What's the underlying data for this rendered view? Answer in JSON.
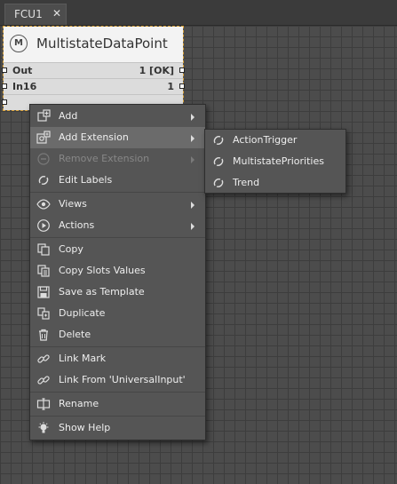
{
  "tab": {
    "label": "FCU1",
    "close_glyph": "✕"
  },
  "node": {
    "title": "MultistateDataPoint",
    "icon_letter": "M",
    "icon": "multistate-icon",
    "slots": [
      {
        "name": "Out",
        "value": "1 [OK]"
      },
      {
        "name": "In16",
        "value": "1"
      }
    ]
  },
  "context_menu": {
    "items": [
      {
        "label": "Add",
        "icon": "add-icon",
        "submenu": true
      },
      {
        "label": "Add Extension",
        "icon": "add-extension-icon",
        "submenu": true,
        "highlighted": true
      },
      {
        "label": "Remove Extension",
        "icon": "remove-extension-icon",
        "submenu": true,
        "disabled": true
      },
      {
        "label": "Edit Labels",
        "icon": "edit-labels-icon"
      },
      {
        "label": "Views",
        "icon": "eye-icon",
        "submenu": true
      },
      {
        "label": "Actions",
        "icon": "play-icon",
        "submenu": true
      },
      {
        "label": "Copy",
        "icon": "copy-icon"
      },
      {
        "label": "Copy Slots Values",
        "icon": "copy-slots-icon"
      },
      {
        "label": "Save as Template",
        "icon": "save-template-icon"
      },
      {
        "label": "Duplicate",
        "icon": "duplicate-icon"
      },
      {
        "label": "Delete",
        "icon": "trash-icon"
      },
      {
        "label": "Link Mark",
        "icon": "link-icon"
      },
      {
        "label": "Link From 'UniversalInput'",
        "icon": "link-from-icon"
      },
      {
        "label": "Rename",
        "icon": "rename-icon"
      },
      {
        "label": "Show Help",
        "icon": "help-bulb-icon"
      }
    ]
  },
  "submenu": {
    "items": [
      {
        "label": "ActionTrigger",
        "icon": "extension-icon"
      },
      {
        "label": "MultistatePriorities",
        "icon": "extension-icon"
      },
      {
        "label": "Trend",
        "icon": "extension-icon"
      }
    ]
  },
  "colors": {
    "canvas": "#4c4c4c",
    "grid": "#3d3d3d",
    "menu_bg": "#555555",
    "menu_highlight": "#6b6b6b",
    "node_header": "#f3f3f3",
    "node_slot": "#dcdcdc",
    "selection_border": "#d9a23a"
  }
}
